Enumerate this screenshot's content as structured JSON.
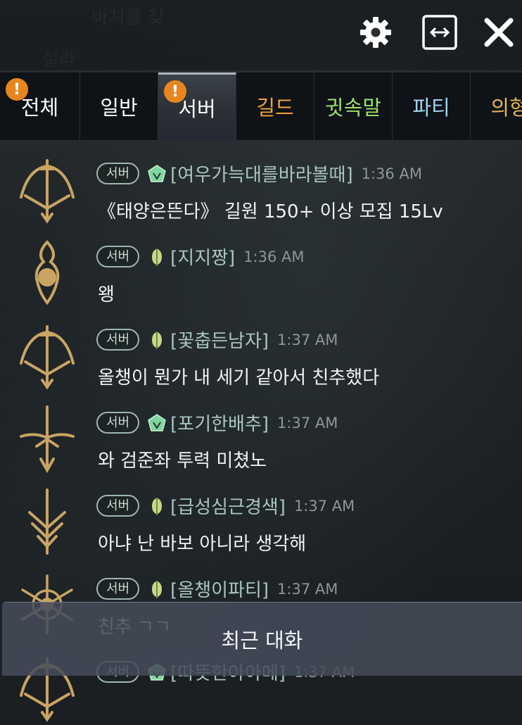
{
  "window": {
    "icons": [
      "gear-icon",
      "resize-horizontal-icon",
      "close-icon"
    ]
  },
  "tabs": [
    {
      "label": "전체",
      "color": "#ffffff",
      "badge": "!",
      "active": false
    },
    {
      "label": "일반",
      "color": "#ffffff",
      "badge": null,
      "active": false
    },
    {
      "label": "서버",
      "color": "#ffffff",
      "badge": "!",
      "active": true
    },
    {
      "label": "길드",
      "color": "#f0a23c",
      "badge": null,
      "active": false
    },
    {
      "label": "귓속말",
      "color": "#98e36e",
      "badge": null,
      "active": false
    },
    {
      "label": "파티",
      "color": "#9ed6f2",
      "badge": null,
      "active": false
    },
    {
      "label": "의형",
      "color": "#e6b45a",
      "badge": null,
      "active": false
    }
  ],
  "messages": [
    {
      "channel": "서버",
      "rank": "crest",
      "name": "[여우가늑대를바라볼때]",
      "time": "1:36 AM",
      "text": "《태양은뜬다》 길원 150+ 이상 모집 15Lv",
      "emblem": "bow"
    },
    {
      "channel": "서버",
      "rank": "leaf",
      "name": "[지지짱]",
      "time": "1:36 AM",
      "text": "왱",
      "emblem": "orb"
    },
    {
      "channel": "서버",
      "rank": "leaf",
      "name": "[꽃춥든남자]",
      "time": "1:37 AM",
      "text": "올챙이 뭔가 내 세기 같아서 친추했다",
      "emblem": "bow"
    },
    {
      "channel": "서버",
      "rank": "crest",
      "name": "[포기한배추]",
      "time": "1:37 AM",
      "text": "와 검준좌 투력 미쳤노",
      "emblem": "sword"
    },
    {
      "channel": "서버",
      "rank": "leaf",
      "name": "[급성심근경색]",
      "time": "1:37 AM",
      "text": "아냐 난 바보 아니라 생각해",
      "emblem": "dagger"
    },
    {
      "channel": "서버",
      "rank": "leaf",
      "name": "[올챙이파티]",
      "time": "1:37 AM",
      "text": "친추 ㄱㄱ",
      "emblem": "star"
    },
    {
      "channel": "서버",
      "rank": "crest",
      "name": "[따뜻한아아메]",
      "time": "1:37 AM",
      "text": "",
      "emblem": "bow"
    }
  ],
  "recent_label": "최근 대화",
  "colors": {
    "accent_orange": "#e7861f",
    "name_teal": "#a8c6c1",
    "emblem_gold": "#c9a463"
  }
}
